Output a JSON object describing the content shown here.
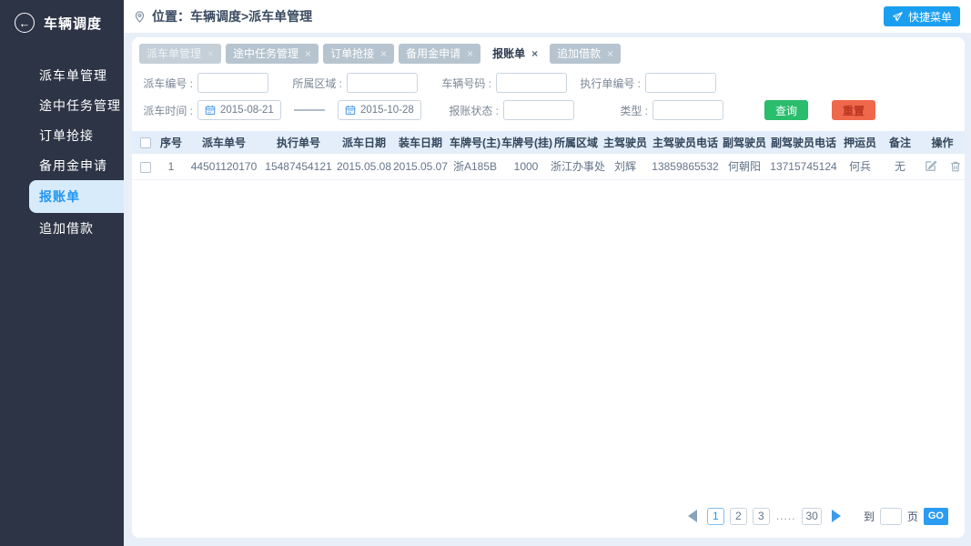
{
  "ui": {
    "close_glyph": "×",
    "back_glyph": "←",
    "ellipsis": "....."
  },
  "colors": {
    "sidebar_bg": "#2d3445",
    "accent_blue": "#2196f3",
    "quick_button": "#1a9ff0",
    "search_green": "#2abd6c",
    "reset_orange": "#f0684b",
    "tab_inactive": "#b6c4cf",
    "table_header_bg": "#e4eefa",
    "page_bg": "#e9eff8"
  },
  "sidebar": {
    "title": "车辆调度",
    "items": [
      {
        "label": "派车单管理",
        "active": false
      },
      {
        "label": "途中任务管理",
        "active": false
      },
      {
        "label": "订单抢接",
        "active": false
      },
      {
        "label": "备用金申请",
        "active": false
      },
      {
        "label": "报账单",
        "active": true
      },
      {
        "label": "追加借款",
        "active": false
      }
    ]
  },
  "topbar": {
    "breadcrumb": "位置：车辆调度>派车单管理",
    "quick_menu_label": "快捷菜单"
  },
  "tabs": [
    {
      "label": "派车单管理",
      "state": "home"
    },
    {
      "label": "途中任务管理",
      "state": "normal"
    },
    {
      "label": "订单抢接",
      "state": "normal"
    },
    {
      "label": "备用金申请",
      "state": "normal"
    },
    {
      "label": "报账单",
      "state": "active"
    },
    {
      "label": "追加借款",
      "state": "normal"
    }
  ],
  "filters": {
    "dispatch_no_label": "派车编号 :",
    "region_label": "所属区域 :",
    "vehicle_no_label": "车辆号码 :",
    "exec_no_label": "执行单编号 :",
    "dispatch_time_label": "派车时间 :",
    "date_from": "2015-08-21",
    "date_to": "2015-10-28",
    "status_label": "报账状态 :",
    "type_label": "类型 :",
    "search_label": "查询",
    "reset_label": "重置"
  },
  "table": {
    "headers": [
      "序号",
      "派车单号",
      "执行单号",
      "派车日期",
      "装车日期",
      "车牌号(主)",
      "车牌号(挂)",
      "所属区域",
      "主驾驶员",
      "主驾驶员电话",
      "副驾驶员",
      "副驾驶员电话",
      "押运员",
      "备注",
      "操作"
    ],
    "rows": [
      {
        "seq": "1",
        "dispatch_no": "44501120170",
        "exec_no": "15487454121",
        "dispatch_date": "2015.05.08",
        "load_date": "2015.05.07",
        "plate_main": "浙A185B",
        "plate_trailer": "1000",
        "region": "浙江办事处",
        "driver": "刘辉",
        "driver_phone": "13859865532",
        "co_driver": "何朝阳",
        "co_driver_phone": "13715745124",
        "escort": "何兵",
        "remark": "无"
      }
    ]
  },
  "pagination": {
    "pages": [
      "1",
      "2",
      "3"
    ],
    "last_page": "30",
    "current_page": "1",
    "goto_label": "到",
    "page_unit_label": "页",
    "go_label": "GO"
  }
}
